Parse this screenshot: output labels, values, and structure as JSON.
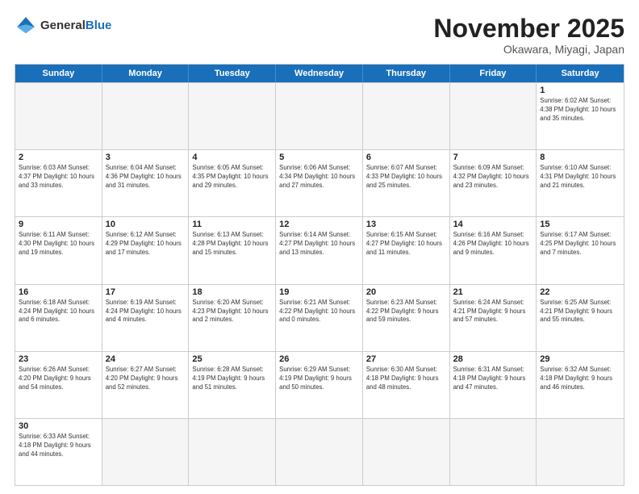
{
  "header": {
    "logo_general": "General",
    "logo_blue": "Blue",
    "month": "November 2025",
    "location": "Okawara, Miyagi, Japan"
  },
  "weekdays": [
    "Sunday",
    "Monday",
    "Tuesday",
    "Wednesday",
    "Thursday",
    "Friday",
    "Saturday"
  ],
  "weeks": [
    [
      {
        "day": "",
        "info": "",
        "empty": true
      },
      {
        "day": "",
        "info": "",
        "empty": true
      },
      {
        "day": "",
        "info": "",
        "empty": true
      },
      {
        "day": "",
        "info": "",
        "empty": true
      },
      {
        "day": "",
        "info": "",
        "empty": true
      },
      {
        "day": "",
        "info": "",
        "empty": true
      },
      {
        "day": "1",
        "info": "Sunrise: 6:02 AM\nSunset: 4:38 PM\nDaylight: 10 hours\nand 35 minutes.",
        "empty": false
      }
    ],
    [
      {
        "day": "2",
        "info": "Sunrise: 6:03 AM\nSunset: 4:37 PM\nDaylight: 10 hours\nand 33 minutes.",
        "empty": false
      },
      {
        "day": "3",
        "info": "Sunrise: 6:04 AM\nSunset: 4:36 PM\nDaylight: 10 hours\nand 31 minutes.",
        "empty": false
      },
      {
        "day": "4",
        "info": "Sunrise: 6:05 AM\nSunset: 4:35 PM\nDaylight: 10 hours\nand 29 minutes.",
        "empty": false
      },
      {
        "day": "5",
        "info": "Sunrise: 6:06 AM\nSunset: 4:34 PM\nDaylight: 10 hours\nand 27 minutes.",
        "empty": false
      },
      {
        "day": "6",
        "info": "Sunrise: 6:07 AM\nSunset: 4:33 PM\nDaylight: 10 hours\nand 25 minutes.",
        "empty": false
      },
      {
        "day": "7",
        "info": "Sunrise: 6:09 AM\nSunset: 4:32 PM\nDaylight: 10 hours\nand 23 minutes.",
        "empty": false
      },
      {
        "day": "8",
        "info": "Sunrise: 6:10 AM\nSunset: 4:31 PM\nDaylight: 10 hours\nand 21 minutes.",
        "empty": false
      }
    ],
    [
      {
        "day": "9",
        "info": "Sunrise: 6:11 AM\nSunset: 4:30 PM\nDaylight: 10 hours\nand 19 minutes.",
        "empty": false
      },
      {
        "day": "10",
        "info": "Sunrise: 6:12 AM\nSunset: 4:29 PM\nDaylight: 10 hours\nand 17 minutes.",
        "empty": false
      },
      {
        "day": "11",
        "info": "Sunrise: 6:13 AM\nSunset: 4:28 PM\nDaylight: 10 hours\nand 15 minutes.",
        "empty": false
      },
      {
        "day": "12",
        "info": "Sunrise: 6:14 AM\nSunset: 4:27 PM\nDaylight: 10 hours\nand 13 minutes.",
        "empty": false
      },
      {
        "day": "13",
        "info": "Sunrise: 6:15 AM\nSunset: 4:27 PM\nDaylight: 10 hours\nand 11 minutes.",
        "empty": false
      },
      {
        "day": "14",
        "info": "Sunrise: 6:16 AM\nSunset: 4:26 PM\nDaylight: 10 hours\nand 9 minutes.",
        "empty": false
      },
      {
        "day": "15",
        "info": "Sunrise: 6:17 AM\nSunset: 4:25 PM\nDaylight: 10 hours\nand 7 minutes.",
        "empty": false
      }
    ],
    [
      {
        "day": "16",
        "info": "Sunrise: 6:18 AM\nSunset: 4:24 PM\nDaylight: 10 hours\nand 6 minutes.",
        "empty": false
      },
      {
        "day": "17",
        "info": "Sunrise: 6:19 AM\nSunset: 4:24 PM\nDaylight: 10 hours\nand 4 minutes.",
        "empty": false
      },
      {
        "day": "18",
        "info": "Sunrise: 6:20 AM\nSunset: 4:23 PM\nDaylight: 10 hours\nand 2 minutes.",
        "empty": false
      },
      {
        "day": "19",
        "info": "Sunrise: 6:21 AM\nSunset: 4:22 PM\nDaylight: 10 hours\nand 0 minutes.",
        "empty": false
      },
      {
        "day": "20",
        "info": "Sunrise: 6:23 AM\nSunset: 4:22 PM\nDaylight: 9 hours\nand 59 minutes.",
        "empty": false
      },
      {
        "day": "21",
        "info": "Sunrise: 6:24 AM\nSunset: 4:21 PM\nDaylight: 9 hours\nand 57 minutes.",
        "empty": false
      },
      {
        "day": "22",
        "info": "Sunrise: 6:25 AM\nSunset: 4:21 PM\nDaylight: 9 hours\nand 55 minutes.",
        "empty": false
      }
    ],
    [
      {
        "day": "23",
        "info": "Sunrise: 6:26 AM\nSunset: 4:20 PM\nDaylight: 9 hours\nand 54 minutes.",
        "empty": false
      },
      {
        "day": "24",
        "info": "Sunrise: 6:27 AM\nSunset: 4:20 PM\nDaylight: 9 hours\nand 52 minutes.",
        "empty": false
      },
      {
        "day": "25",
        "info": "Sunrise: 6:28 AM\nSunset: 4:19 PM\nDaylight: 9 hours\nand 51 minutes.",
        "empty": false
      },
      {
        "day": "26",
        "info": "Sunrise: 6:29 AM\nSunset: 4:19 PM\nDaylight: 9 hours\nand 50 minutes.",
        "empty": false
      },
      {
        "day": "27",
        "info": "Sunrise: 6:30 AM\nSunset: 4:18 PM\nDaylight: 9 hours\nand 48 minutes.",
        "empty": false
      },
      {
        "day": "28",
        "info": "Sunrise: 6:31 AM\nSunset: 4:18 PM\nDaylight: 9 hours\nand 47 minutes.",
        "empty": false
      },
      {
        "day": "29",
        "info": "Sunrise: 6:32 AM\nSunset: 4:18 PM\nDaylight: 9 hours\nand 46 minutes.",
        "empty": false
      }
    ],
    [
      {
        "day": "30",
        "info": "Sunrise: 6:33 AM\nSunset: 4:18 PM\nDaylight: 9 hours\nand 44 minutes.",
        "empty": false
      },
      {
        "day": "",
        "info": "",
        "empty": true
      },
      {
        "day": "",
        "info": "",
        "empty": true
      },
      {
        "day": "",
        "info": "",
        "empty": true
      },
      {
        "day": "",
        "info": "",
        "empty": true
      },
      {
        "day": "",
        "info": "",
        "empty": true
      },
      {
        "day": "",
        "info": "",
        "empty": true
      }
    ]
  ]
}
